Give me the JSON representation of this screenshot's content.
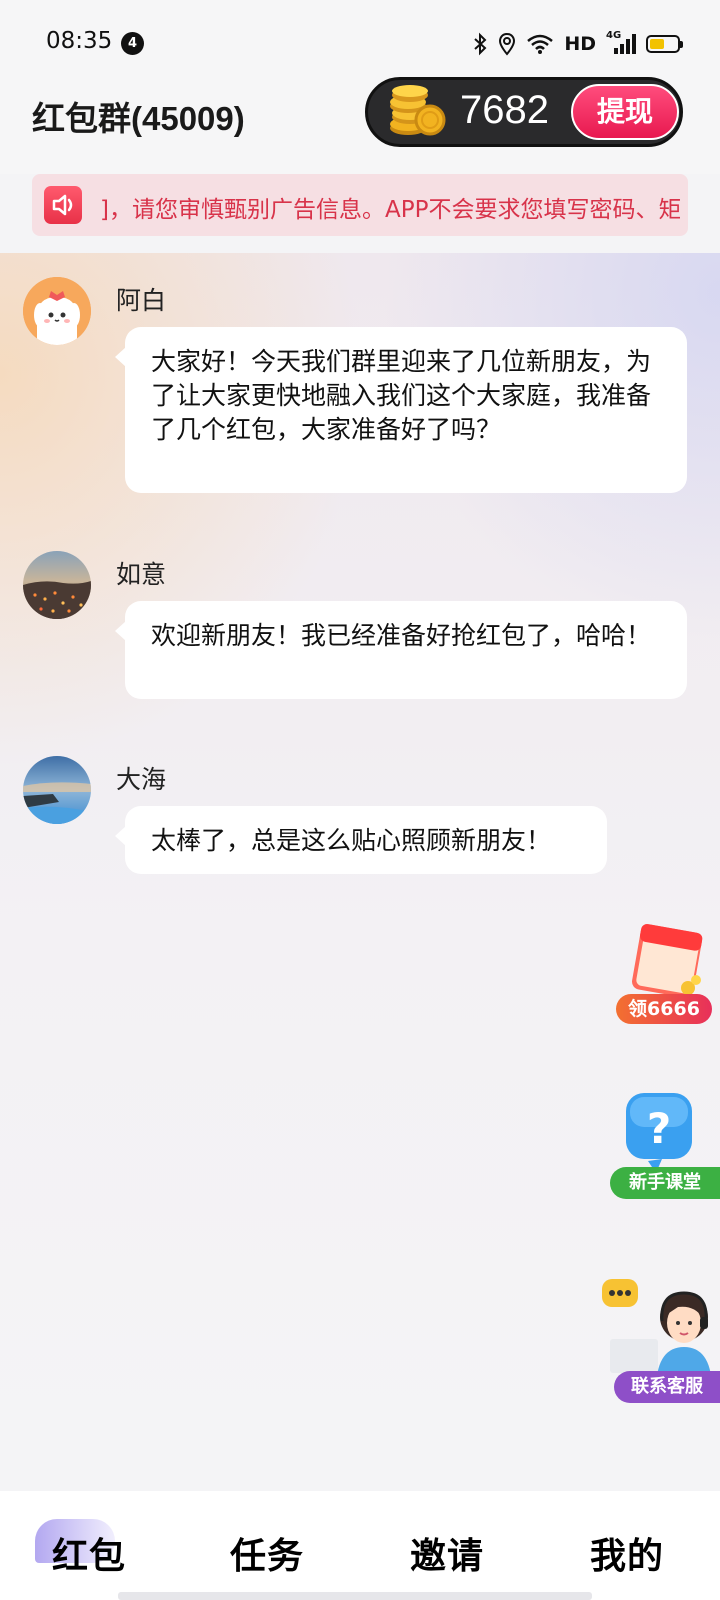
{
  "status_bar": {
    "time": "08:35",
    "notification_count": "4",
    "network_label": "HD",
    "signal_label": "4G",
    "icons": [
      "bluetooth-icon",
      "location-icon",
      "wifi-icon",
      "signal-icon",
      "battery-icon"
    ]
  },
  "header": {
    "title": "红包群(45009)",
    "coin_balance": "7682",
    "withdraw_label": "提现"
  },
  "notice": {
    "text": "]，请您审慎甄别广告信息。APP不会要求您填写密码、矩"
  },
  "messages": [
    {
      "sender": "阿白",
      "text": "大家好！今天我们群里迎来了几位新朋友，为了让大家更快地融入我们这个大家庭，我准备了几个红包，大家准备好了吗？"
    },
    {
      "sender": "如意",
      "text": "欢迎新朋友！我已经准备好抢红包了，哈哈！"
    },
    {
      "sender": "大海",
      "text": "太棒了，总是这么贴心照顾新朋友！"
    }
  ],
  "floating": {
    "reward_label": "领6666",
    "tutorial_label": "新手课堂",
    "support_label": "联系客服"
  },
  "nav": {
    "items": [
      "红包",
      "任务",
      "邀请",
      "我的"
    ],
    "active": "红包"
  },
  "colors": {
    "accent_red": "#e8194f",
    "notice_text": "#d8334a",
    "nav_active": "#b3a8f0",
    "tutorial_green": "#3cb043",
    "support_purple": "#8e4fc8",
    "reward_orange": "#f06a2a"
  }
}
